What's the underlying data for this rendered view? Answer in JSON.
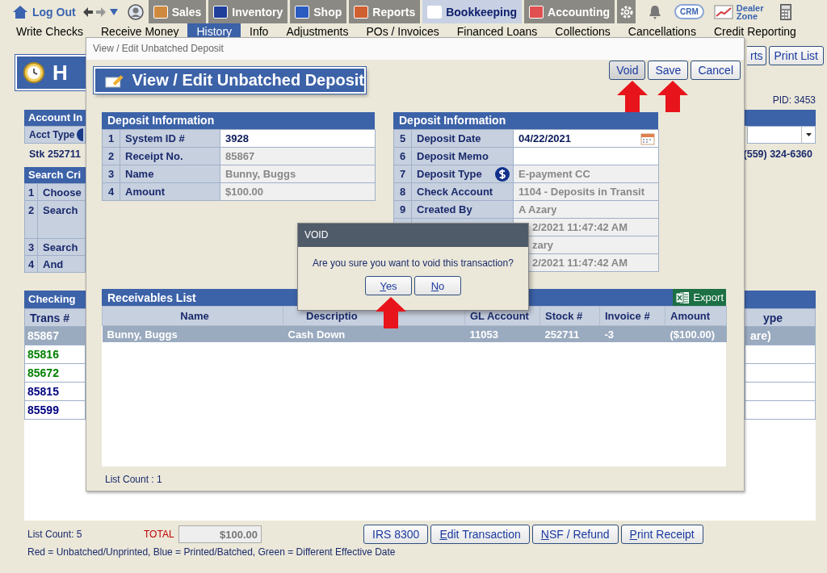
{
  "toolbar": {
    "logout": "Log Out",
    "tabs": [
      {
        "label": "Sales",
        "selected": false
      },
      {
        "label": "Inventory",
        "selected": false
      },
      {
        "label": "Shop",
        "selected": false
      },
      {
        "label": "Reports",
        "selected": false
      },
      {
        "label": "Bookkeeping",
        "selected": true
      },
      {
        "label": "Accounting",
        "selected": false
      }
    ],
    "crm": "CRM",
    "dealer_zone": "Dealer Zone"
  },
  "menu": [
    {
      "label": "Write Checks",
      "selected": false
    },
    {
      "label": "Receive Money",
      "selected": false
    },
    {
      "label": "History",
      "selected": true
    },
    {
      "label": "Info",
      "selected": false
    },
    {
      "label": "Adjustments",
      "selected": false
    },
    {
      "label": "POs / Invoices",
      "selected": false
    },
    {
      "label": "Financed Loans",
      "selected": false
    },
    {
      "label": "Collections",
      "selected": false
    },
    {
      "label": "Cancellations",
      "selected": false
    },
    {
      "label": "Credit Reporting",
      "selected": false
    }
  ],
  "page": {
    "heading": "H",
    "buttons": [
      {
        "label": "rts"
      },
      {
        "label": "Print List"
      }
    ],
    "pid": "PID: 3453",
    "account_panel": {
      "title": "Account In",
      "acct_type_label": "Acct Type",
      "stock": "Stk 252711",
      "phone": "(559) 324-6360"
    },
    "search_panel": {
      "title": "Search Cri",
      "rows": [
        {
          "num": "1",
          "label": "Choose"
        },
        {
          "num": "2",
          "label": "Search"
        },
        {
          "num": "3",
          "label": "Search"
        },
        {
          "num": "4",
          "label": "And"
        }
      ]
    },
    "checking_panel": {
      "title": "Checking",
      "columns": [
        "Trans #",
        "ype"
      ],
      "rows": [
        {
          "trans": "85867",
          "type": "are)",
          "selected": true
        },
        {
          "trans": "85816",
          "selected": false,
          "color": "#008000"
        },
        {
          "trans": "85672",
          "selected": false,
          "color": "#008000"
        },
        {
          "trans": "85815",
          "selected": false,
          "color": "#000080"
        },
        {
          "trans": "85599",
          "selected": false,
          "color": "#000080"
        }
      ]
    }
  },
  "footer": {
    "list_count": "List Count: 5",
    "total_label": "TOTAL",
    "total": "$100.00",
    "buttons": [
      {
        "label": "IRS 8300",
        "underlined_key": false
      },
      {
        "label": "Edit Transaction",
        "underlined_key": true
      },
      {
        "label": "NSF / Refund",
        "underlined_key": true
      },
      {
        "label": "Print Receipt",
        "underlined_key": true
      }
    ],
    "legend": "Red = Unbatched/Unprinted, Blue = Printed/Batched, Green = Different Effective Date"
  },
  "modal": {
    "title": "View / Edit Unbatched Deposit",
    "heading": "View / Edit Unbatched Deposit",
    "buttons": [
      {
        "label": "Void",
        "focused": true
      },
      {
        "label": "Save",
        "focused": false
      },
      {
        "label": "Cancel",
        "focused": false
      }
    ],
    "left_panel": {
      "title": "Deposit Information",
      "rows": [
        {
          "num": "1",
          "label": "System ID #",
          "value": "3928",
          "editable": true,
          "kind": "plain"
        },
        {
          "num": "2",
          "label": "Receipt No.",
          "value": "85867",
          "editable": false,
          "kind": "plain"
        },
        {
          "num": "3",
          "label": "Name",
          "value": "Bunny, Buggs",
          "editable": false,
          "kind": "plain"
        },
        {
          "num": "4",
          "label": "Amount",
          "value": "$100.00",
          "editable": false,
          "kind": "plain"
        }
      ]
    },
    "right_panel": {
      "title": "Deposit Information",
      "rows": [
        {
          "num": "5",
          "label": "Deposit Date",
          "value": "04/22/2021",
          "editable": true,
          "kind": "date"
        },
        {
          "num": "6",
          "label": "Deposit Memo",
          "editable": true,
          "kind": "plain"
        },
        {
          "num": "7",
          "label": "Deposit Type",
          "value": "E-payment CC",
          "editable": false,
          "kind": "dollar"
        },
        {
          "num": "8",
          "label": "Check Account",
          "value": "1104 - Deposits in Transit",
          "editable": false,
          "kind": "plain"
        },
        {
          "num": "9",
          "label": "Created By",
          "value": "A Azary",
          "editable": false,
          "kind": "plain"
        },
        {
          "value": "2/2021 11:47:42 AM",
          "editable": false,
          "kind": "plain"
        },
        {
          "value": "zary",
          "editable": false,
          "kind": "plain"
        },
        {
          "value": "2/2021 11:47:42 AM",
          "editable": false,
          "kind": "plain"
        }
      ]
    },
    "receivables": {
      "title": "Receivables List",
      "export": "Export",
      "columns": [
        "Name",
        "Descriptio",
        "GL Account",
        "Stock #",
        "Invoice #",
        "Amount"
      ],
      "rows": [
        {
          "cells": [
            "Bunny, Buggs",
            "Cash Down",
            "11053",
            "252711",
            "-3",
            "($100.00)"
          ],
          "selected": true
        }
      ],
      "list_count": "List Count : 1"
    }
  },
  "dialog": {
    "title": "VOID",
    "message": "Are you sure you want to void this transaction?",
    "buttons": [
      {
        "label": "Yes",
        "underlined_key": true
      },
      {
        "label": "No",
        "underlined_key": true
      }
    ]
  }
}
